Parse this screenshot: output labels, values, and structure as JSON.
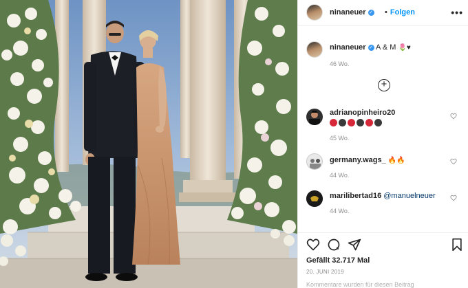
{
  "post": {
    "author": {
      "username": "ninaneuer",
      "follow_label": "Folgen",
      "more_icon": "more-horizontal-icon"
    },
    "caption": {
      "username": "ninaneuer",
      "text": "A & M",
      "emoji": "🌷♥",
      "time": "46 Wo."
    },
    "load_more_icon": "plus-circle-icon",
    "comments": [
      {
        "username": "adrianopinheiro20",
        "circles": [
          "#d62839",
          "#3a3a3a",
          "#d62839",
          "#3a3a3a",
          "#d62839",
          "#3a3a3a"
        ],
        "time": "45 Wo."
      },
      {
        "username": "germany.wags_",
        "emoji": "🔥🔥",
        "time": "44 Wo."
      },
      {
        "username": "marilibertad16",
        "mention": "@manuelneuer",
        "time": "44 Wo."
      }
    ],
    "actions": {
      "like_icon": "heart-icon",
      "comment_icon": "comment-icon",
      "share_icon": "send-icon",
      "save_icon": "bookmark-icon"
    },
    "likes_text": "Gefällt 32.717 Mal",
    "date": "20. JUNI 2019",
    "comments_disabled_text": "Kommentare wurden für diesen Beitrag"
  },
  "colors": {
    "link_blue": "#0095f6",
    "verified_blue": "#3897f0",
    "text": "#262626",
    "muted": "#8e8e8e"
  }
}
